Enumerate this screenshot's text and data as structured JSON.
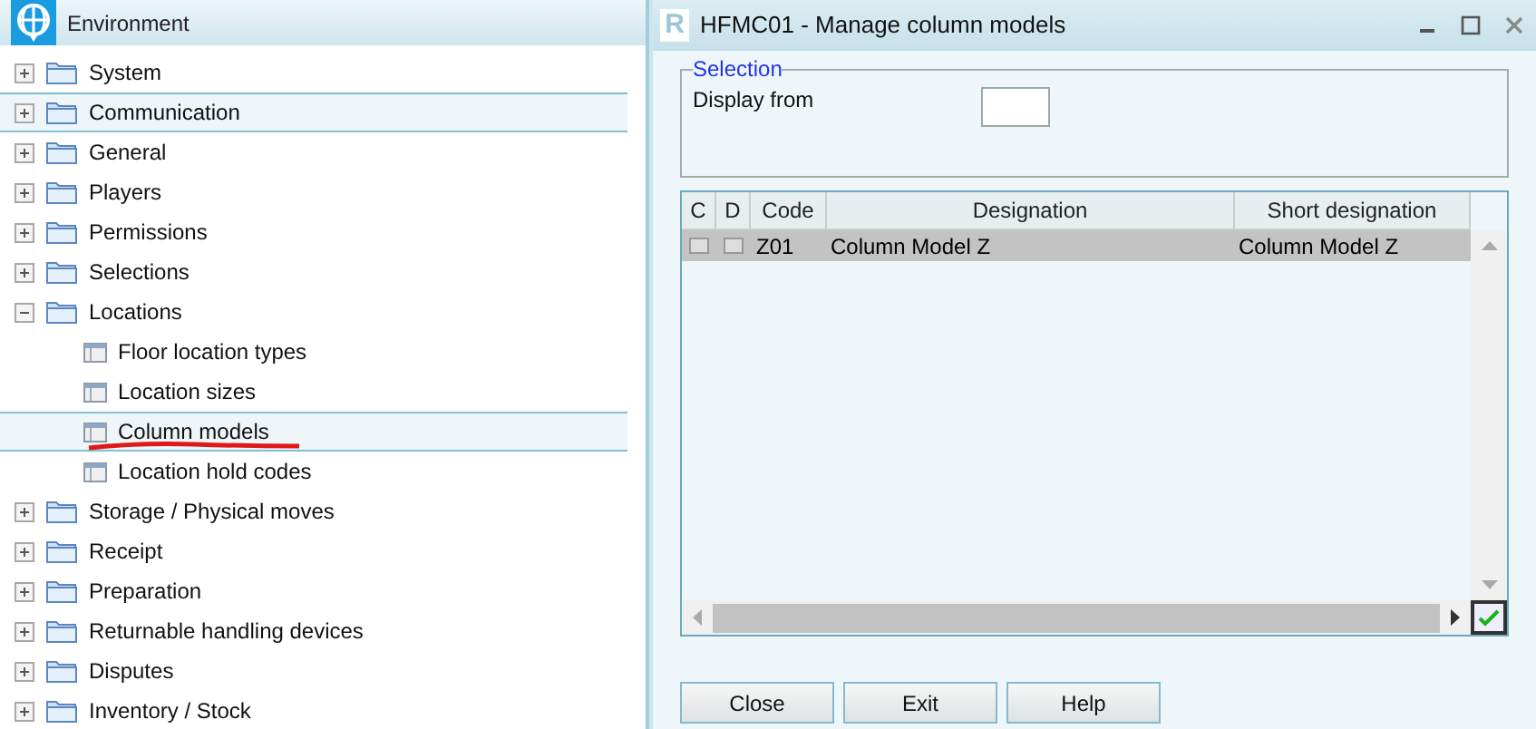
{
  "left_panel": {
    "title": "Environment"
  },
  "tree": [
    {
      "label": "System",
      "kind": "folder",
      "expanded": false,
      "selected": false
    },
    {
      "label": "Communication",
      "kind": "folder",
      "expanded": false,
      "selected": true
    },
    {
      "label": "General",
      "kind": "folder",
      "expanded": false,
      "selected": false
    },
    {
      "label": "Players",
      "kind": "folder",
      "expanded": false,
      "selected": false
    },
    {
      "label": "Permissions",
      "kind": "folder",
      "expanded": false,
      "selected": false
    },
    {
      "label": "Selections",
      "kind": "folder",
      "expanded": false,
      "selected": false
    },
    {
      "label": "Locations",
      "kind": "folder",
      "expanded": true,
      "selected": false,
      "children": [
        {
          "label": "Floor location types",
          "kind": "table",
          "selected": false,
          "underlined": false
        },
        {
          "label": "Location sizes",
          "kind": "table",
          "selected": false,
          "underlined": false
        },
        {
          "label": "Column models",
          "kind": "table",
          "selected": true,
          "underlined": true
        },
        {
          "label": "Location hold codes",
          "kind": "table",
          "selected": false,
          "underlined": false
        }
      ]
    },
    {
      "label": "Storage / Physical moves",
      "kind": "folder",
      "expanded": false,
      "selected": false
    },
    {
      "label": "Receipt",
      "kind": "folder",
      "expanded": false,
      "selected": false
    },
    {
      "label": "Preparation",
      "kind": "folder",
      "expanded": false,
      "selected": false
    },
    {
      "label": "Returnable handling devices",
      "kind": "folder",
      "expanded": false,
      "selected": false
    },
    {
      "label": "Disputes",
      "kind": "folder",
      "expanded": false,
      "selected": false
    },
    {
      "label": "Inventory / Stock",
      "kind": "folder",
      "expanded": false,
      "selected": false
    }
  ],
  "window": {
    "logo": "R",
    "title": "HFMC01 - Manage column models"
  },
  "selection": {
    "legend": "Selection",
    "label": "Display from"
  },
  "table": {
    "columns": [
      "C",
      "D",
      "Code",
      "Designation",
      "Short designation"
    ],
    "rows": [
      {
        "c": false,
        "d": false,
        "code": "Z01",
        "designation": "Column Model Z",
        "short_designation": "Column Model Z",
        "selected": true
      }
    ]
  },
  "buttons": [
    "Close",
    "Exit",
    "Help"
  ]
}
